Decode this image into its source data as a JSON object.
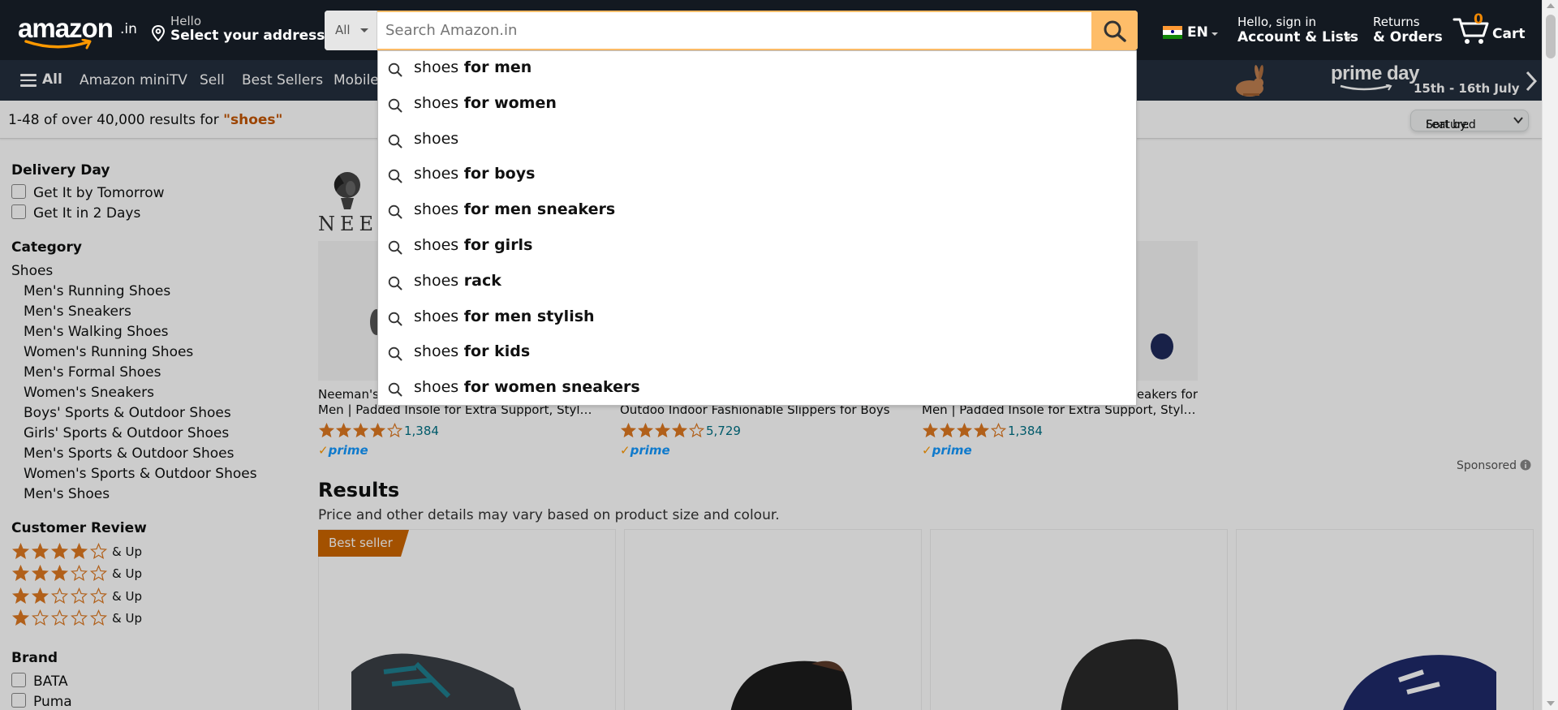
{
  "header": {
    "logo_word": "amazon",
    "logo_tld": ".in",
    "address_line1": "Hello",
    "address_line2": "Select your address",
    "search_dept": "All",
    "search_placeholder": "Search Amazon.in",
    "lang_code": "EN",
    "account_line1": "Hello, sign in",
    "account_line2": "Account & Lists",
    "orders_line1": "Returns",
    "orders_line2": "& Orders",
    "cart_count": "0",
    "cart_label": "Cart"
  },
  "nav": {
    "all_label": "All",
    "links": [
      "Amazon miniTV",
      "Sell",
      "Best Sellers",
      "Mobile"
    ],
    "banner_title": "prime day",
    "banner_dates": "15th - 16th July"
  },
  "results_bar": {
    "prefix": "1-48 of over 40,000 results for ",
    "query": "\"shoes\"",
    "sort_label": "Sort by:",
    "sort_value": "Featured"
  },
  "sidebar": {
    "delivery_title": "Delivery Day",
    "delivery_options": [
      "Get It by Tomorrow",
      "Get It in 2 Days"
    ],
    "category_title": "Category",
    "category_root": "Shoes",
    "categories": [
      "Men's Running Shoes",
      "Men's Sneakers",
      "Men's Walking Shoes",
      "Women's Running Shoes",
      "Men's Formal Shoes",
      "Women's Sneakers",
      "Boys' Sports & Outdoor Shoes",
      "Girls' Sports & Outdoor Shoes",
      "Men's Sports & Outdoor Shoes",
      "Women's Sports & Outdoor Shoes",
      "Men's Shoes"
    ],
    "review_title": "Customer Review",
    "review_rows": [
      {
        "stars": 4,
        "label": "& Up"
      },
      {
        "stars": 3,
        "label": "& Up"
      },
      {
        "stars": 2,
        "label": "& Up"
      },
      {
        "stars": 1,
        "label": "& Up"
      }
    ],
    "brand_title": "Brand",
    "brands": [
      "BATA",
      "Puma"
    ]
  },
  "sponsored": {
    "brand_logo_text": "NEEMAN",
    "products": [
      {
        "title1": "Neeman's R",
        "title2": "Men | Padded Insole for Extra Support, Stylish S...",
        "rating": 4.0,
        "count": "1,384",
        "prime": "prime"
      },
      {
        "title1": "",
        "title2": "Outdoo Indoor Fashionable Slippers for Boys",
        "rating": 4.0,
        "count": "5,729",
        "prime": "prime"
      },
      {
        "title1": "neakers for",
        "title2": "Men | Padded Insole for Extra Support, Stylish S...",
        "rating": 4.0,
        "count": "1,384",
        "prime": "prime"
      }
    ],
    "sponsored_label": "Sponsored"
  },
  "results": {
    "heading": "Results",
    "subtext": "Price and other details may vary based on product size and colour.",
    "badge": "Best seller"
  },
  "autocomplete": [
    {
      "prefix": "shoes",
      "suffix": " for men"
    },
    {
      "prefix": "shoes",
      "suffix": " for women"
    },
    {
      "prefix": "shoes",
      "suffix": ""
    },
    {
      "prefix": "shoes",
      "suffix": " for boys"
    },
    {
      "prefix": "shoes",
      "suffix": " for men sneakers"
    },
    {
      "prefix": "shoes",
      "suffix": " for girls"
    },
    {
      "prefix": "shoes",
      "suffix": " rack"
    },
    {
      "prefix": "shoes",
      "suffix": " for men stylish"
    },
    {
      "prefix": "shoes",
      "suffix": " for kids"
    },
    {
      "prefix": "shoes",
      "suffix": " for women sneakers"
    }
  ],
  "colors": {
    "nav_belt": "#131921",
    "nav_main": "#232f3e",
    "search_button": "#febd69",
    "star": "#de7921",
    "link": "#007185",
    "query": "#c45500",
    "badge": "#cc6600"
  }
}
